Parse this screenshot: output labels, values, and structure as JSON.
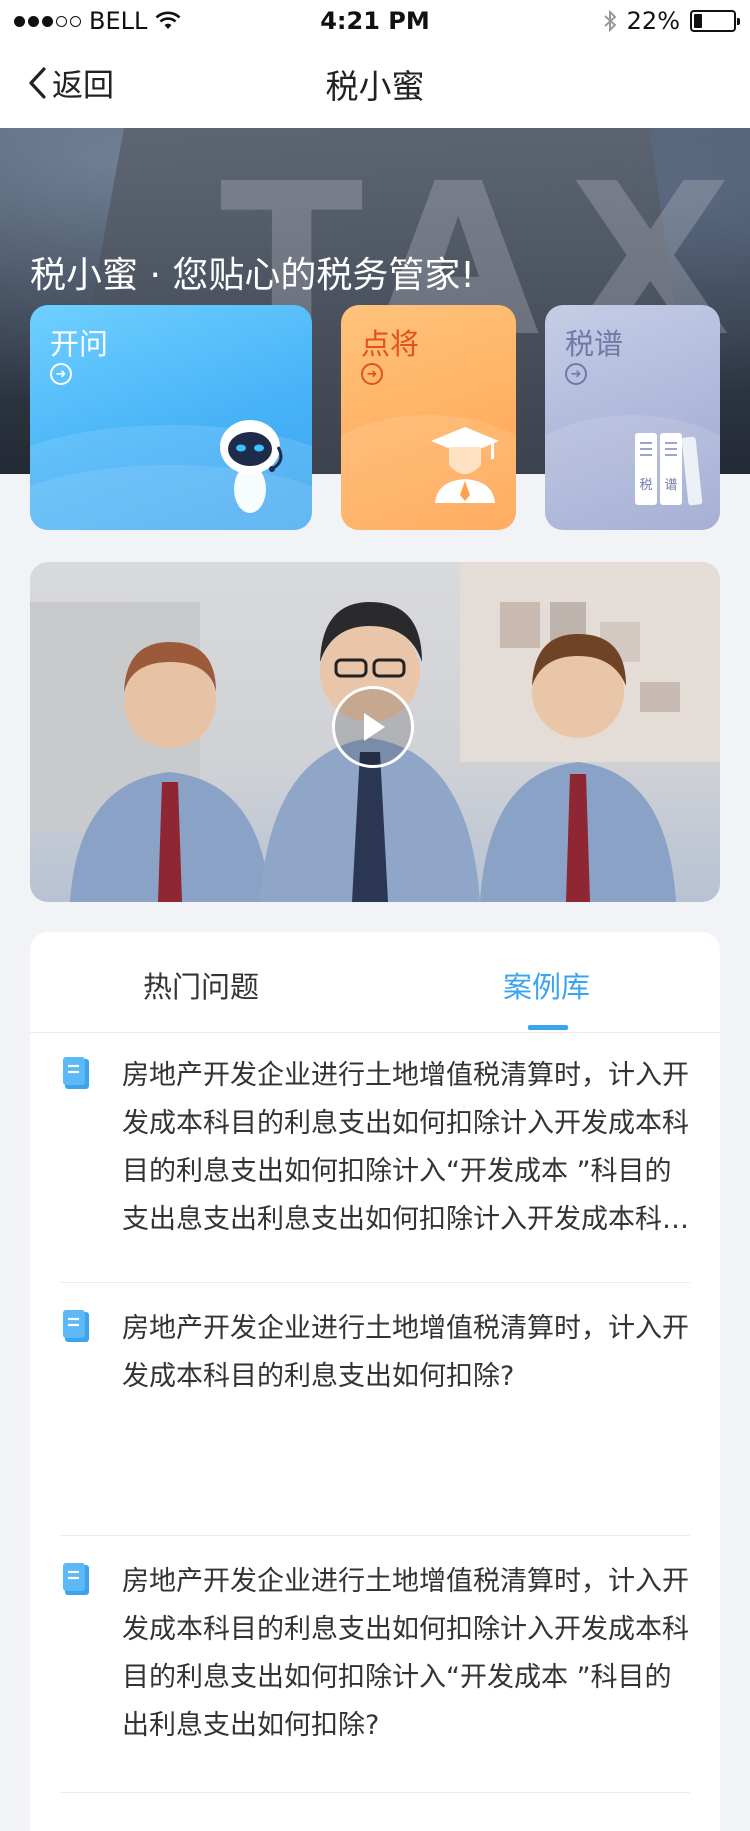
{
  "status_bar": {
    "carrier": "BELL",
    "time": "4:21 PM",
    "battery": "22%",
    "battery_level": 0.22
  },
  "nav": {
    "back_label": "返回",
    "title": "税小蜜"
  },
  "hero": {
    "slogan": "税小蜜 · 您贴心的税务管家!",
    "background_text": "TAX"
  },
  "cards": [
    {
      "title": "开问",
      "icon": "robot-icon",
      "color": "#48b3f7"
    },
    {
      "title": "点将",
      "icon": "expert-icon",
      "color": "#ffa24c"
    },
    {
      "title": "税谱",
      "icon": "books-icon",
      "color": "#9ba6cf",
      "book_labels": [
        "税",
        "谱"
      ]
    }
  ],
  "video": {
    "icon": "play-icon"
  },
  "tabs": [
    {
      "label": "热门问题",
      "active": false
    },
    {
      "label": "案例库",
      "active": true
    }
  ],
  "accent_color": "#3aa4f0",
  "questions": [
    {
      "text": "房地产开发企业进行土地增值税清算时，计入开发成本科目的利息支出如何扣除计入开发成本科目的利息支出如何扣除计入“开发成本 ”科目的支出息支出利息支出如何扣除计入开发成本科目的利息支出如何扣除？"
    },
    {
      "text": "房地产开发企业进行土地增值税清算时，计入开发成本科目的利息支出如何扣除?"
    },
    {
      "text": "房地产开发企业进行土地增值税清算时，计入开发成本科目的利息支出如何扣除计入开发成本科目的利息支出如何扣除计入“开发成本 ”科目的出利息支出如何扣除?"
    }
  ]
}
